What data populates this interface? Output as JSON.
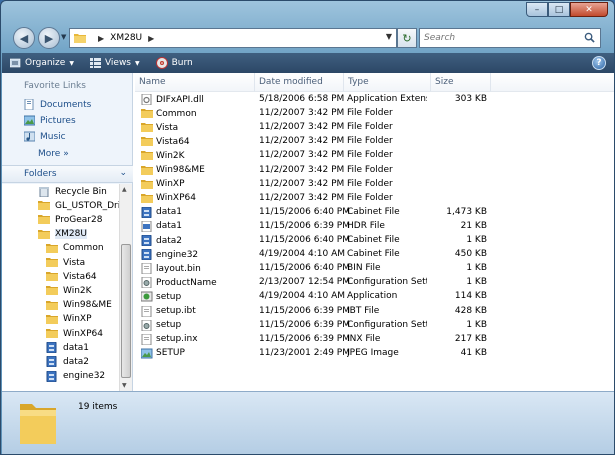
{
  "window": {
    "close_label": "✕",
    "max_label": "□",
    "min_label": "–"
  },
  "address": {
    "path": "XM28U",
    "search_placeholder": "Search"
  },
  "toolbar": {
    "organize": "Organize",
    "views": "Views",
    "burn": "Burn",
    "help": "?"
  },
  "nav": {
    "favorite_links_title": "Favorite Links",
    "favorites": [
      "Documents",
      "Pictures",
      "Music"
    ],
    "more": "More",
    "folders_title": "Folders",
    "tree": [
      "Recycle Bin",
      "GL_USTOR_Drive",
      "ProGear28",
      "XM28U",
      "Common",
      "Vista",
      "Vista64",
      "Win2K",
      "Win98&ME",
      "WinXP",
      "WinXP64",
      "data1",
      "data2",
      "engine32"
    ]
  },
  "columns": {
    "name": "Name",
    "date": "Date modified",
    "type": "Type",
    "size": "Size"
  },
  "files": [
    {
      "name": "DIFxAPI.dll",
      "date": "5/18/2006 6:58 PM",
      "type": "Application Extens...",
      "size": "303 KB",
      "icon": "dll-icon"
    },
    {
      "name": "Common",
      "date": "11/2/2007 3:42 PM",
      "type": "File Folder",
      "size": "",
      "icon": "folder-icon"
    },
    {
      "name": "Vista",
      "date": "11/2/2007 3:42 PM",
      "type": "File Folder",
      "size": "",
      "icon": "folder-icon"
    },
    {
      "name": "Vista64",
      "date": "11/2/2007 3:42 PM",
      "type": "File Folder",
      "size": "",
      "icon": "folder-icon"
    },
    {
      "name": "Win2K",
      "date": "11/2/2007 3:42 PM",
      "type": "File Folder",
      "size": "",
      "icon": "folder-icon"
    },
    {
      "name": "Win98&ME",
      "date": "11/2/2007 3:42 PM",
      "type": "File Folder",
      "size": "",
      "icon": "folder-icon"
    },
    {
      "name": "WinXP",
      "date": "11/2/2007 3:42 PM",
      "type": "File Folder",
      "size": "",
      "icon": "folder-icon"
    },
    {
      "name": "WinXP64",
      "date": "11/2/2007 3:42 PM",
      "type": "File Folder",
      "size": "",
      "icon": "folder-icon"
    },
    {
      "name": "data1",
      "date": "11/15/2006 6:40 PM",
      "type": "Cabinet File",
      "size": "1,473 KB",
      "icon": "cabinet-icon"
    },
    {
      "name": "data1",
      "date": "11/15/2006 6:39 PM",
      "type": "HDR File",
      "size": "21 KB",
      "icon": "hdr-file-icon"
    },
    {
      "name": "data2",
      "date": "11/15/2006 6:40 PM",
      "type": "Cabinet File",
      "size": "1 KB",
      "icon": "cabinet-icon"
    },
    {
      "name": "engine32",
      "date": "4/19/2004 4:10 AM",
      "type": "Cabinet File",
      "size": "450 KB",
      "icon": "cabinet-icon"
    },
    {
      "name": "layout.bin",
      "date": "11/15/2006 6:40 PM",
      "type": "BIN File",
      "size": "1 KB",
      "icon": "file-icon"
    },
    {
      "name": "ProductName",
      "date": "2/13/2007 12:54 PM",
      "type": "Configuration Sett...",
      "size": "1 KB",
      "icon": "config-icon"
    },
    {
      "name": "setup",
      "date": "4/19/2004 4:10 AM",
      "type": "Application",
      "size": "114 KB",
      "icon": "setup-icon"
    },
    {
      "name": "setup.ibt",
      "date": "11/15/2006 6:39 PM",
      "type": "IBT File",
      "size": "428 KB",
      "icon": "file-icon"
    },
    {
      "name": "setup",
      "date": "11/15/2006 6:39 PM",
      "type": "Configuration Sett...",
      "size": "1 KB",
      "icon": "config-icon"
    },
    {
      "name": "setup.inx",
      "date": "11/15/2006 6:39 PM",
      "type": "INX File",
      "size": "217 KB",
      "icon": "file-icon"
    },
    {
      "name": "SETUP",
      "date": "11/23/2001 2:49 PM",
      "type": "JPEG Image",
      "size": "41 KB",
      "icon": "image-icon"
    }
  ],
  "details": {
    "item_count": "19 items"
  }
}
